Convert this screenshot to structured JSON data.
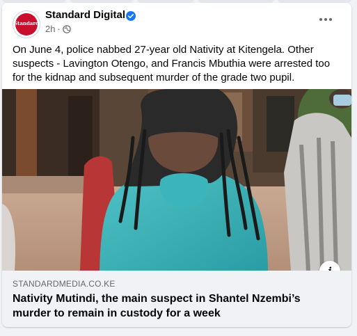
{
  "post": {
    "page_name": "Standard Digital",
    "logo_text": "Standard",
    "time": "2h",
    "separator": "·",
    "caption": "On June 4, police nabbed 27-year old Nativity at Kitengela. Other suspects - Lavington Otengo, and Francis Mbuthia were arrested too for the kidnap and subsequent murder of the grade two pupil."
  },
  "link_preview": {
    "domain": "STANDARDMEDIA.CO.KE",
    "headline": "Nativity Mutindi, the main suspect in Shantel Nzembi’s murder to remain in custody for a week",
    "info_label": "i"
  },
  "icons": {
    "verified": "verified-badge-icon",
    "audience": "globe-icon",
    "more": "more-options-icon",
    "info": "info-icon"
  },
  "colors": {
    "verified_blue": "#1877f2",
    "brand_red": "#c8102e",
    "background": "#f0f2f5"
  }
}
